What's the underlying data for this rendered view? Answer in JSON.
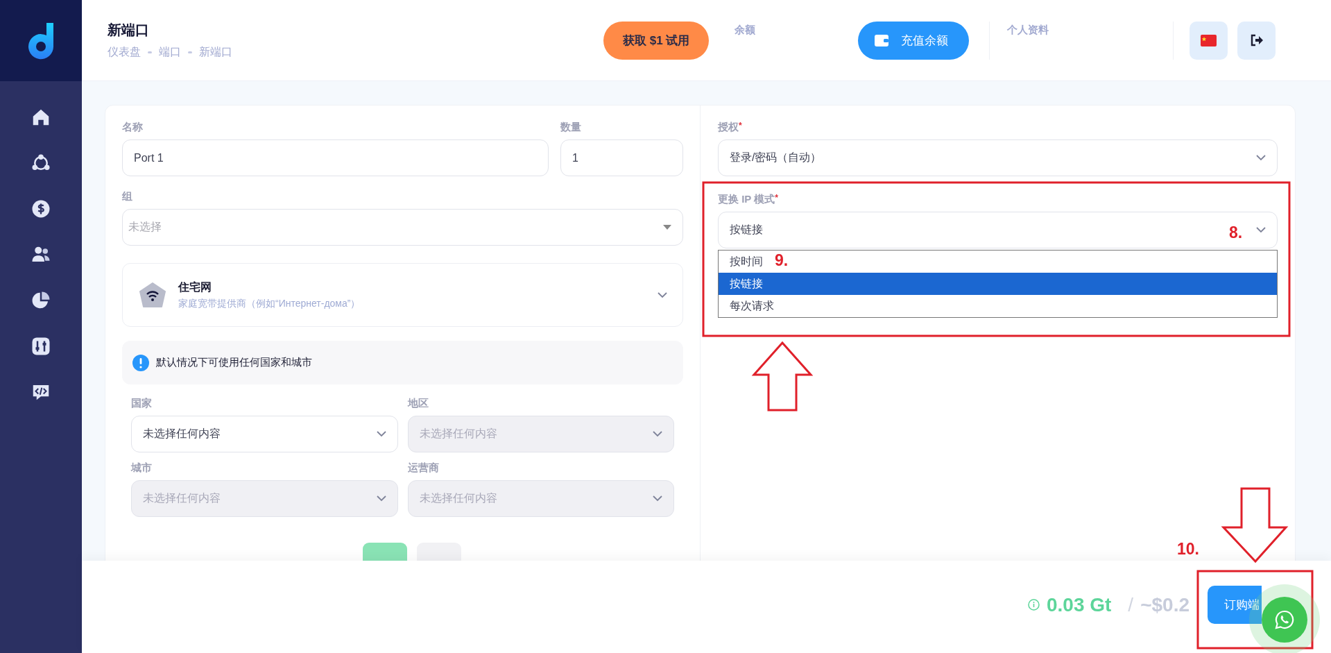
{
  "header": {
    "title": "新端口",
    "breadcrumbs": [
      "仪表盘",
      "端口",
      "新端口"
    ],
    "trial_button": "获取 $1 试用",
    "balance_label": "余额",
    "topup_button": "充值余额",
    "profile_label": "个人资料"
  },
  "form": {
    "name_field": {
      "label": "名称",
      "value": "Port 1"
    },
    "quantity_field": {
      "label": "数量",
      "value": "1"
    },
    "group_field": {
      "label": "组",
      "placeholder": "未选择"
    },
    "proxy_type": {
      "title": "住宅网",
      "subtitle": "家庭宽带提供商（例如“Интернет-дома”）"
    },
    "info": "默认情况下可使用任何国家和城市",
    "location_fields": [
      {
        "label": "国家",
        "placeholder": "未选择任何内容",
        "disabled": false
      },
      {
        "label": "地区",
        "placeholder": "未选择任何内容",
        "disabled": true
      },
      {
        "label": "城市",
        "placeholder": "未选择任何内容",
        "disabled": true
      },
      {
        "label": "运营商",
        "placeholder": "未选择任何内容",
        "disabled": true
      }
    ],
    "auth_field": {
      "label": "授权",
      "required_mark": "*",
      "value": "登录/密码（自动）"
    },
    "rotation_field": {
      "label": "更换 IP 模式",
      "required_mark": "*",
      "value": "按链接",
      "options": [
        {
          "label": "按时间",
          "selected": false
        },
        {
          "label": "按链接",
          "selected": true
        },
        {
          "label": "每次请求",
          "selected": false
        }
      ]
    }
  },
  "footer": {
    "price": "0.03 Gt",
    "separator": "/",
    "price_usd": "~$0.2",
    "order_button": "订购端"
  },
  "annotations": [
    {
      "text": "8."
    },
    {
      "text": "9."
    },
    {
      "text": "10."
    }
  ]
}
